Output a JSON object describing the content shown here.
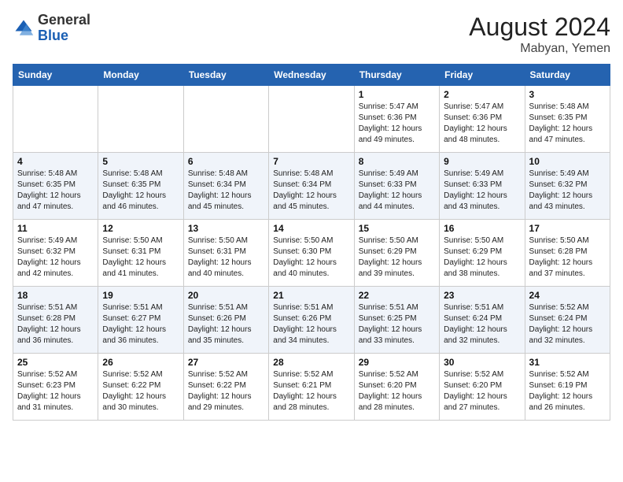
{
  "header": {
    "logo_general": "General",
    "logo_blue": "Blue",
    "month_year": "August 2024",
    "location": "Mabyan, Yemen"
  },
  "days_of_week": [
    "Sunday",
    "Monday",
    "Tuesday",
    "Wednesday",
    "Thursday",
    "Friday",
    "Saturday"
  ],
  "weeks": [
    [
      {
        "day": "",
        "detail": ""
      },
      {
        "day": "",
        "detail": ""
      },
      {
        "day": "",
        "detail": ""
      },
      {
        "day": "",
        "detail": ""
      },
      {
        "day": "1",
        "detail": "Sunrise: 5:47 AM\nSunset: 6:36 PM\nDaylight: 12 hours\nand 49 minutes."
      },
      {
        "day": "2",
        "detail": "Sunrise: 5:47 AM\nSunset: 6:36 PM\nDaylight: 12 hours\nand 48 minutes."
      },
      {
        "day": "3",
        "detail": "Sunrise: 5:48 AM\nSunset: 6:35 PM\nDaylight: 12 hours\nand 47 minutes."
      }
    ],
    [
      {
        "day": "4",
        "detail": "Sunrise: 5:48 AM\nSunset: 6:35 PM\nDaylight: 12 hours\nand 47 minutes."
      },
      {
        "day": "5",
        "detail": "Sunrise: 5:48 AM\nSunset: 6:35 PM\nDaylight: 12 hours\nand 46 minutes."
      },
      {
        "day": "6",
        "detail": "Sunrise: 5:48 AM\nSunset: 6:34 PM\nDaylight: 12 hours\nand 45 minutes."
      },
      {
        "day": "7",
        "detail": "Sunrise: 5:48 AM\nSunset: 6:34 PM\nDaylight: 12 hours\nand 45 minutes."
      },
      {
        "day": "8",
        "detail": "Sunrise: 5:49 AM\nSunset: 6:33 PM\nDaylight: 12 hours\nand 44 minutes."
      },
      {
        "day": "9",
        "detail": "Sunrise: 5:49 AM\nSunset: 6:33 PM\nDaylight: 12 hours\nand 43 minutes."
      },
      {
        "day": "10",
        "detail": "Sunrise: 5:49 AM\nSunset: 6:32 PM\nDaylight: 12 hours\nand 43 minutes."
      }
    ],
    [
      {
        "day": "11",
        "detail": "Sunrise: 5:49 AM\nSunset: 6:32 PM\nDaylight: 12 hours\nand 42 minutes."
      },
      {
        "day": "12",
        "detail": "Sunrise: 5:50 AM\nSunset: 6:31 PM\nDaylight: 12 hours\nand 41 minutes."
      },
      {
        "day": "13",
        "detail": "Sunrise: 5:50 AM\nSunset: 6:31 PM\nDaylight: 12 hours\nand 40 minutes."
      },
      {
        "day": "14",
        "detail": "Sunrise: 5:50 AM\nSunset: 6:30 PM\nDaylight: 12 hours\nand 40 minutes."
      },
      {
        "day": "15",
        "detail": "Sunrise: 5:50 AM\nSunset: 6:29 PM\nDaylight: 12 hours\nand 39 minutes."
      },
      {
        "day": "16",
        "detail": "Sunrise: 5:50 AM\nSunset: 6:29 PM\nDaylight: 12 hours\nand 38 minutes."
      },
      {
        "day": "17",
        "detail": "Sunrise: 5:50 AM\nSunset: 6:28 PM\nDaylight: 12 hours\nand 37 minutes."
      }
    ],
    [
      {
        "day": "18",
        "detail": "Sunrise: 5:51 AM\nSunset: 6:28 PM\nDaylight: 12 hours\nand 36 minutes."
      },
      {
        "day": "19",
        "detail": "Sunrise: 5:51 AM\nSunset: 6:27 PM\nDaylight: 12 hours\nand 36 minutes."
      },
      {
        "day": "20",
        "detail": "Sunrise: 5:51 AM\nSunset: 6:26 PM\nDaylight: 12 hours\nand 35 minutes."
      },
      {
        "day": "21",
        "detail": "Sunrise: 5:51 AM\nSunset: 6:26 PM\nDaylight: 12 hours\nand 34 minutes."
      },
      {
        "day": "22",
        "detail": "Sunrise: 5:51 AM\nSunset: 6:25 PM\nDaylight: 12 hours\nand 33 minutes."
      },
      {
        "day": "23",
        "detail": "Sunrise: 5:51 AM\nSunset: 6:24 PM\nDaylight: 12 hours\nand 32 minutes."
      },
      {
        "day": "24",
        "detail": "Sunrise: 5:52 AM\nSunset: 6:24 PM\nDaylight: 12 hours\nand 32 minutes."
      }
    ],
    [
      {
        "day": "25",
        "detail": "Sunrise: 5:52 AM\nSunset: 6:23 PM\nDaylight: 12 hours\nand 31 minutes."
      },
      {
        "day": "26",
        "detail": "Sunrise: 5:52 AM\nSunset: 6:22 PM\nDaylight: 12 hours\nand 30 minutes."
      },
      {
        "day": "27",
        "detail": "Sunrise: 5:52 AM\nSunset: 6:22 PM\nDaylight: 12 hours\nand 29 minutes."
      },
      {
        "day": "28",
        "detail": "Sunrise: 5:52 AM\nSunset: 6:21 PM\nDaylight: 12 hours\nand 28 minutes."
      },
      {
        "day": "29",
        "detail": "Sunrise: 5:52 AM\nSunset: 6:20 PM\nDaylight: 12 hours\nand 28 minutes."
      },
      {
        "day": "30",
        "detail": "Sunrise: 5:52 AM\nSunset: 6:20 PM\nDaylight: 12 hours\nand 27 minutes."
      },
      {
        "day": "31",
        "detail": "Sunrise: 5:52 AM\nSunset: 6:19 PM\nDaylight: 12 hours\nand 26 minutes."
      }
    ]
  ]
}
